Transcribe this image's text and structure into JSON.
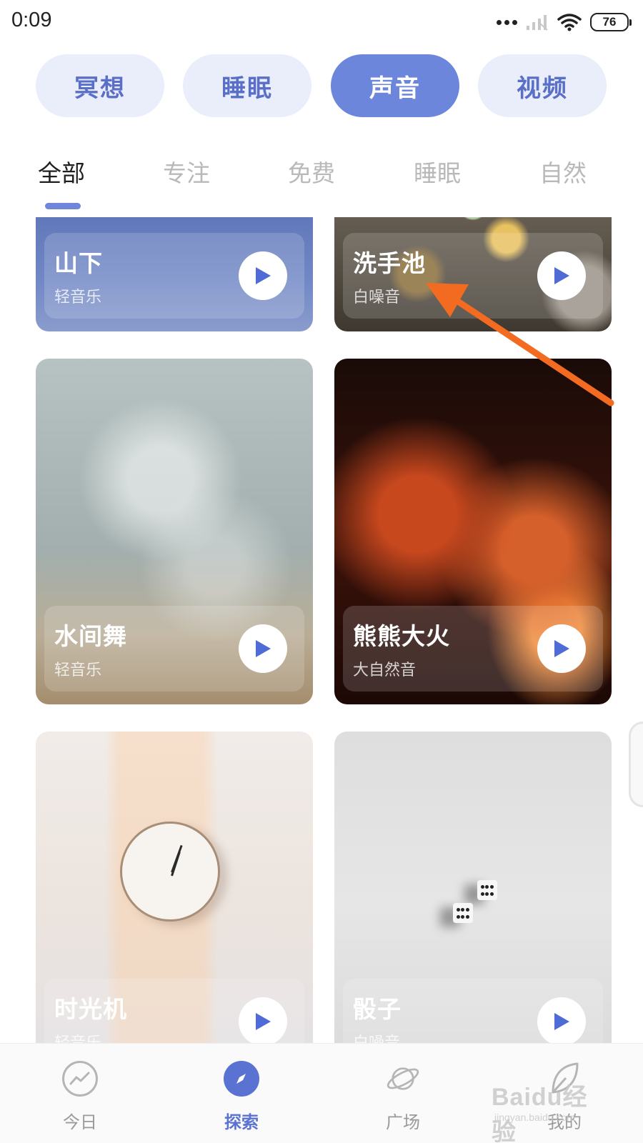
{
  "status_bar": {
    "time": "0:09",
    "battery": "76"
  },
  "category_pills": [
    {
      "label": "冥想",
      "active": false
    },
    {
      "label": "睡眠",
      "active": false
    },
    {
      "label": "声音",
      "active": true
    },
    {
      "label": "视频",
      "active": false
    }
  ],
  "sub_tabs": [
    {
      "label": "全部",
      "active": true
    },
    {
      "label": "专注",
      "active": false
    },
    {
      "label": "免费",
      "active": false
    },
    {
      "label": "睡眠",
      "active": false
    },
    {
      "label": "自然",
      "active": false
    }
  ],
  "cards": [
    {
      "title": "山下",
      "subtitle": "轻音乐",
      "image": "blue-mountain"
    },
    {
      "title": "洗手池",
      "subtitle": "白噪音",
      "image": "sink-bokeh"
    },
    {
      "title": "水间舞",
      "subtitle": "轻音乐",
      "image": "sparkling-water"
    },
    {
      "title": "熊熊大火",
      "subtitle": "大自然音",
      "image": "fire"
    },
    {
      "title": "时光机",
      "subtitle": "轻音乐",
      "image": "wall-clock"
    },
    {
      "title": "骰子",
      "subtitle": "白噪音",
      "image": "dice"
    }
  ],
  "bottom_nav": [
    {
      "label": "今日",
      "icon": "chart-trend-icon",
      "active": false
    },
    {
      "label": "探索",
      "icon": "compass-icon",
      "active": true
    },
    {
      "label": "广场",
      "icon": "planet-icon",
      "active": false
    },
    {
      "label": "我的",
      "icon": "leaf-icon",
      "active": false
    }
  ],
  "watermark": {
    "main": "Baidu经验",
    "sub": "jingyan.baidu.com"
  },
  "colors": {
    "accent": "#6c86dc",
    "pill_bg": "#eaedfa",
    "pill_text": "#5a6fc8",
    "annotation_arrow": "#f26b21"
  }
}
